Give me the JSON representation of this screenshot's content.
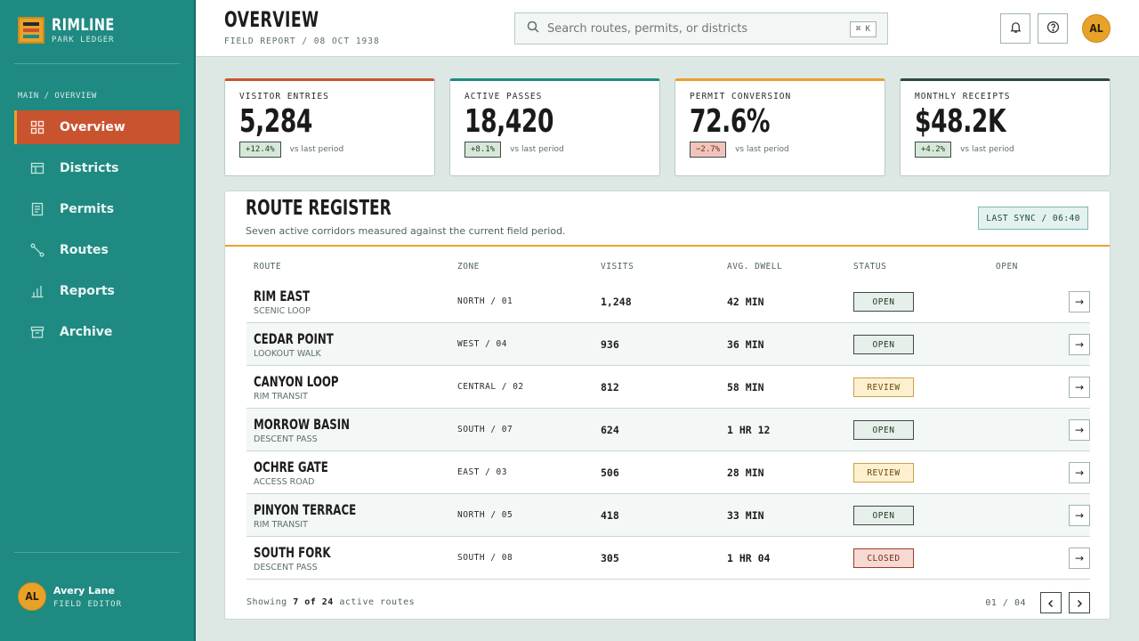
{
  "brand": {
    "name": "RIMLINE",
    "sub": "PARK LEDGER"
  },
  "nav": {
    "section": "MAIN / OVERVIEW",
    "items": [
      {
        "label": "Overview",
        "icon": "grid-icon",
        "active": true
      },
      {
        "label": "Districts",
        "icon": "table-icon",
        "active": false
      },
      {
        "label": "Permits",
        "icon": "document-icon",
        "active": false
      },
      {
        "label": "Routes",
        "icon": "route-icon",
        "active": false
      },
      {
        "label": "Reports",
        "icon": "bar-chart-icon",
        "active": false
      },
      {
        "label": "Archive",
        "icon": "archive-icon",
        "active": false
      }
    ]
  },
  "user": {
    "initials": "AL",
    "name": "Avery Lane",
    "role": "FIELD EDITOR"
  },
  "header": {
    "title": "OVERVIEW",
    "subtitle": "FIELD REPORT / 08 OCT 1938",
    "search_placeholder": "Search routes, permits, or districts",
    "shortcut": "⌘ K",
    "avatar_initials": "AL"
  },
  "kpis": [
    {
      "label": "VISITOR ENTRIES",
      "value": "5,284",
      "delta": "+12.4%",
      "trend": "up",
      "vs": "vs last period",
      "accent": "#c9532f"
    },
    {
      "label": "ACTIVE PASSES",
      "value": "18,420",
      "delta": "+8.1%",
      "trend": "up",
      "vs": "vs last period",
      "accent": "#1f8a82"
    },
    {
      "label": "PERMIT CONVERSION",
      "value": "72.6%",
      "delta": "−2.7%",
      "trend": "down",
      "vs": "vs last period",
      "accent": "#e8a22a"
    },
    {
      "label": "MONTHLY RECEIPTS",
      "value": "$48.2K",
      "delta": "+4.2%",
      "trend": "up",
      "vs": "vs last period",
      "accent": "#2e4a3a"
    }
  ],
  "register": {
    "title": "ROUTE REGISTER",
    "subtitle": "Seven active corridors measured against the current field period.",
    "sync": "LAST SYNC / 06:40",
    "columns": [
      "ROUTE",
      "ZONE",
      "VISITS",
      "AVG. DWELL",
      "STATUS",
      "OPEN"
    ],
    "rows": [
      {
        "name": "RIM EAST",
        "type": "SCENIC LOOP",
        "zone": "NORTH / 01",
        "visits": "1,248",
        "dwell": "42 MIN",
        "status": "OPEN",
        "status_kind": "open"
      },
      {
        "name": "CEDAR POINT",
        "type": "LOOKOUT WALK",
        "zone": "WEST / 04",
        "visits": "936",
        "dwell": "36 MIN",
        "status": "OPEN",
        "status_kind": "open"
      },
      {
        "name": "CANYON LOOP",
        "type": "RIM TRANSIT",
        "zone": "CENTRAL / 02",
        "visits": "812",
        "dwell": "58 MIN",
        "status": "REVIEW",
        "status_kind": "review"
      },
      {
        "name": "MORROW BASIN",
        "type": "DESCENT PASS",
        "zone": "SOUTH / 07",
        "visits": "624",
        "dwell": "1 HR 12",
        "status": "OPEN",
        "status_kind": "open"
      },
      {
        "name": "OCHRE GATE",
        "type": "ACCESS ROAD",
        "zone": "EAST / 03",
        "visits": "506",
        "dwell": "28 MIN",
        "status": "REVIEW",
        "status_kind": "review"
      },
      {
        "name": "PINYON TERRACE",
        "type": "RIM TRANSIT",
        "zone": "NORTH / 05",
        "visits": "418",
        "dwell": "33 MIN",
        "status": "OPEN",
        "status_kind": "open"
      },
      {
        "name": "SOUTH FORK",
        "type": "DESCENT PASS",
        "zone": "SOUTH / 08",
        "visits": "305",
        "dwell": "1 HR 04",
        "status": "CLOSED",
        "status_kind": "closed"
      }
    ],
    "footer": {
      "prefix": "Showing",
      "shown": "7 of 24",
      "suffix": "active routes",
      "page": "01 / 04"
    }
  }
}
